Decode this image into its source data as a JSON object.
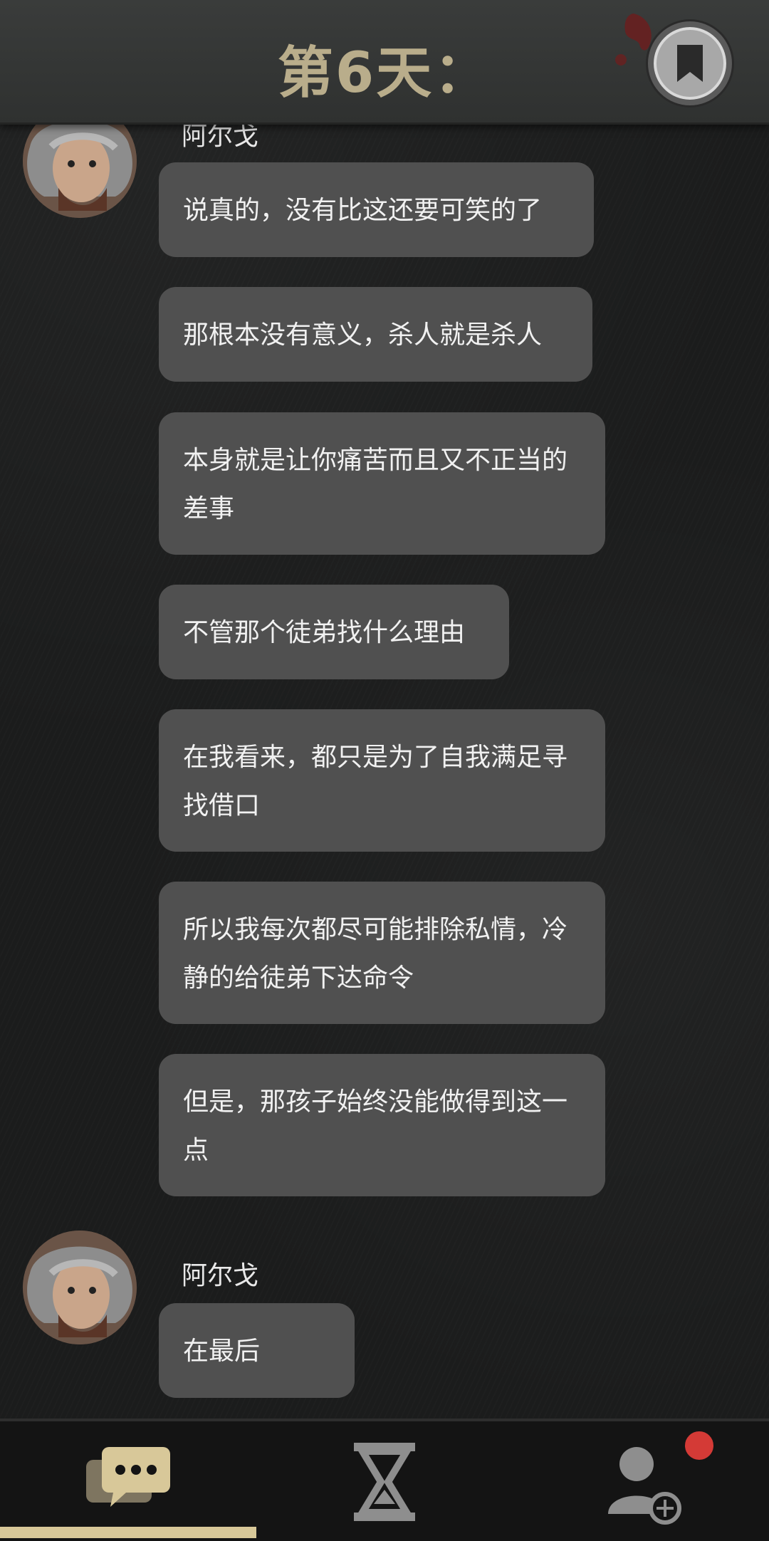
{
  "header": {
    "title": "第6天：",
    "bookmark_icon": "bookmark-icon"
  },
  "chat": {
    "partial_sender": "阿尔戈",
    "messages": [
      "说真的，没有比这还要可笑的了",
      "那根本没有意义，杀人就是杀人",
      "本身就是让你痛苦而且又不正当的差事",
      "不管那个徒弟找什么理由",
      "在我看来，都只是为了自我满足寻找借口",
      "所以我每次都尽可能排除私情，冷静的给徒弟下达命令",
      "但是，那孩子始终没能做得到这一点"
    ],
    "last_sender": "阿尔戈",
    "last_message": "在最后"
  },
  "nav": {
    "items": [
      "chat-icon",
      "hourglass-icon",
      "add-contact-icon"
    ],
    "active": "chat",
    "accent": "#d8c899",
    "badge_color": "#d43a36"
  }
}
